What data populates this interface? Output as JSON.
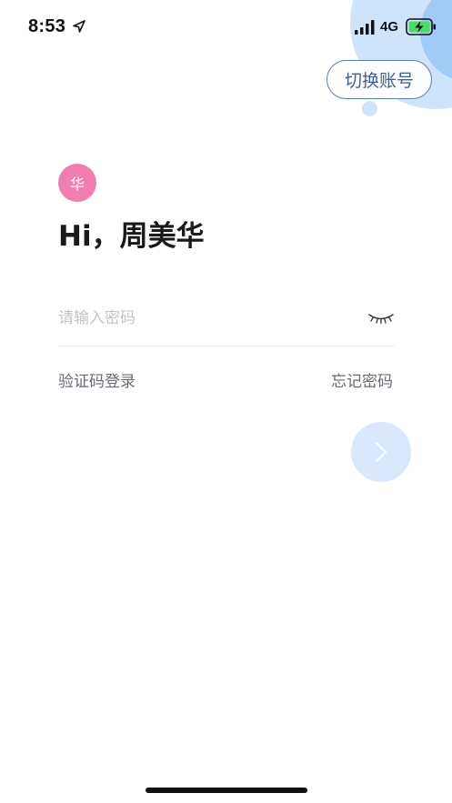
{
  "status_bar": {
    "time": "8:53",
    "network": "4G",
    "icons": [
      "location-arrow-icon",
      "signal-bars-icon",
      "battery-charging-icon"
    ]
  },
  "header": {
    "switch_account_label": "切换账号"
  },
  "profile": {
    "avatar_text": "华",
    "avatar_color": "#ee7fb0",
    "greeting": "Hi，周美华"
  },
  "login_form": {
    "password_placeholder": "请输入密码",
    "password_value": "",
    "sms_login_label": "验证码登录",
    "forgot_password_label": "忘记密码"
  },
  "colors": {
    "accent": "#3f5f8e",
    "bubble_light": "#cfe4fb",
    "bubble_dark": "#9fcbf6",
    "next_button": "#d9e8fb"
  }
}
